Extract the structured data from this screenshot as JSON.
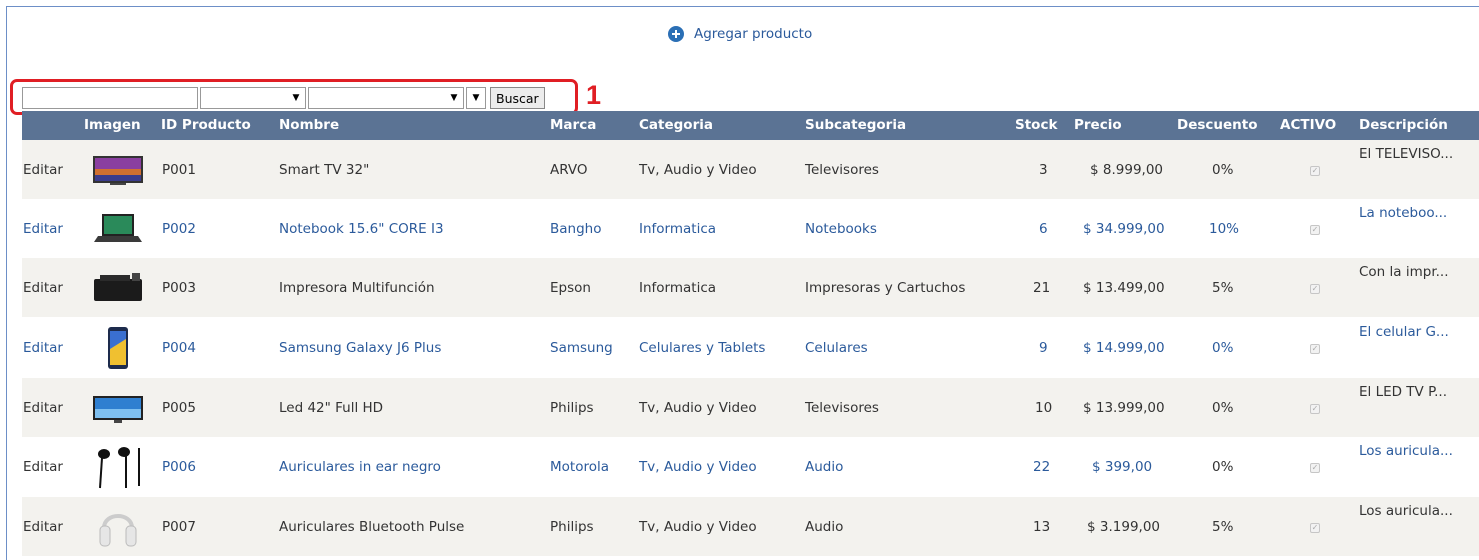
{
  "add_product": {
    "label": "Agregar producto",
    "icon": "plus-circle-icon"
  },
  "filters": {
    "search_value": "",
    "select1_value": "",
    "select2_value": "",
    "select3_value": "",
    "search_button": "Buscar"
  },
  "callout": {
    "number": "1"
  },
  "table": {
    "headers": {
      "imagen": "Imagen",
      "id": "ID Producto",
      "nombre": "Nombre",
      "marca": "Marca",
      "categoria": "Categoria",
      "subcategoria": "Subcategoria",
      "stock": "Stock",
      "precio": "Precio",
      "descuento": "Descuento",
      "activo": "ACTIVO",
      "descripcion": "Descripción"
    },
    "rows": [
      {
        "edit": "Editar",
        "id": "P001",
        "nombre": "Smart TV 32\"",
        "marca": "ARVO",
        "categoria": "Tv, Audio y Video",
        "subcategoria": "Televisores",
        "stock": "3",
        "precio": "$ 8.999,00",
        "descuento": "0%",
        "activo": true,
        "descripcion": "El TELEVISO..."
      },
      {
        "edit": "Editar",
        "id": "P002",
        "nombre": "Notebook 15.6\" CORE I3",
        "marca": "Bangho",
        "categoria": "Informatica",
        "subcategoria": "Notebooks",
        "stock": "6",
        "precio": "$ 34.999,00",
        "descuento": "10%",
        "activo": true,
        "descripcion": "La noteboo..."
      },
      {
        "edit": "Editar",
        "id": "P003",
        "nombre": "Impresora Multifunción",
        "marca": "Epson",
        "categoria": "Informatica",
        "subcategoria": "Impresoras y Cartuchos",
        "stock": "21",
        "precio": "$ 13.499,00",
        "descuento": "5%",
        "activo": true,
        "descripcion": "Con la impr..."
      },
      {
        "edit": "Editar",
        "id": "P004",
        "nombre": "Samsung Galaxy J6 Plus",
        "marca": "Samsung",
        "categoria": "Celulares y Tablets",
        "subcategoria": "Celulares",
        "stock": "9",
        "precio": "$ 14.999,00",
        "descuento": "0%",
        "activo": true,
        "descripcion": "El celular G..."
      },
      {
        "edit": "Editar",
        "id": "P005",
        "nombre": "Led 42\" Full HD",
        "marca": "Philips",
        "categoria": "Tv, Audio y Video",
        "subcategoria": "Televisores",
        "stock": "10",
        "precio": "$ 13.999,00",
        "descuento": "0%",
        "activo": true,
        "descripcion": "El LED TV P..."
      },
      {
        "edit": "Editar",
        "id": "P006",
        "nombre": "Auriculares in ear negro",
        "marca": "Motorola",
        "categoria": "Tv, Audio y Video",
        "subcategoria": "Audio",
        "stock": "22",
        "precio": "$ 399,00",
        "descuento": "0%",
        "activo": true,
        "descripcion": "Los auricula..."
      },
      {
        "edit": "Editar",
        "id": "P007",
        "nombre": "Auriculares Bluetooth Pulse",
        "marca": "Philips",
        "categoria": "Tv, Audio y Video",
        "subcategoria": "Audio",
        "stock": "13",
        "precio": "$ 3.199,00",
        "descuento": "5%",
        "activo": true,
        "descripcion": "Los auricula..."
      }
    ]
  },
  "colors": {
    "header_bg": "#5b7394",
    "link": "#2b5a9b",
    "highlight": "#e01e24",
    "alt_row": "#f3f2ee"
  }
}
